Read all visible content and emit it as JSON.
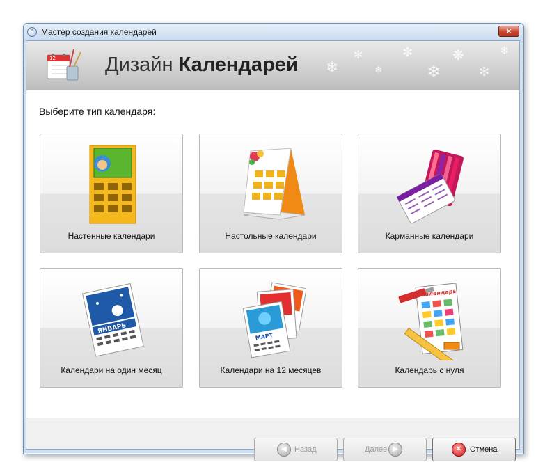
{
  "window": {
    "title": "Мастер создания календарей",
    "close_symbol": "✕"
  },
  "banner": {
    "title_light": "Дизайн",
    "title_bold": "Календарей",
    "icon_number": "12"
  },
  "main": {
    "prompt": "Выберите тип календаря:",
    "tiles": [
      {
        "label": "Настенные календари"
      },
      {
        "label": "Настольные календари"
      },
      {
        "label": "Карманные календари"
      },
      {
        "label": "Календари на один месяц",
        "month": "ЯНВАРЬ"
      },
      {
        "label": "Календари на 12 месяцев",
        "month": "МАРТ"
      },
      {
        "label": "Календарь с нуля",
        "sheet_title": "Календарь"
      }
    ]
  },
  "footer": {
    "back_label": "Назад",
    "next_label": "Далее",
    "cancel_label": "Отмена"
  },
  "colors": {
    "accent_orange": "#f0a020",
    "cancel_red": "#d11a1a",
    "title_bar": "#c9dcf0"
  }
}
